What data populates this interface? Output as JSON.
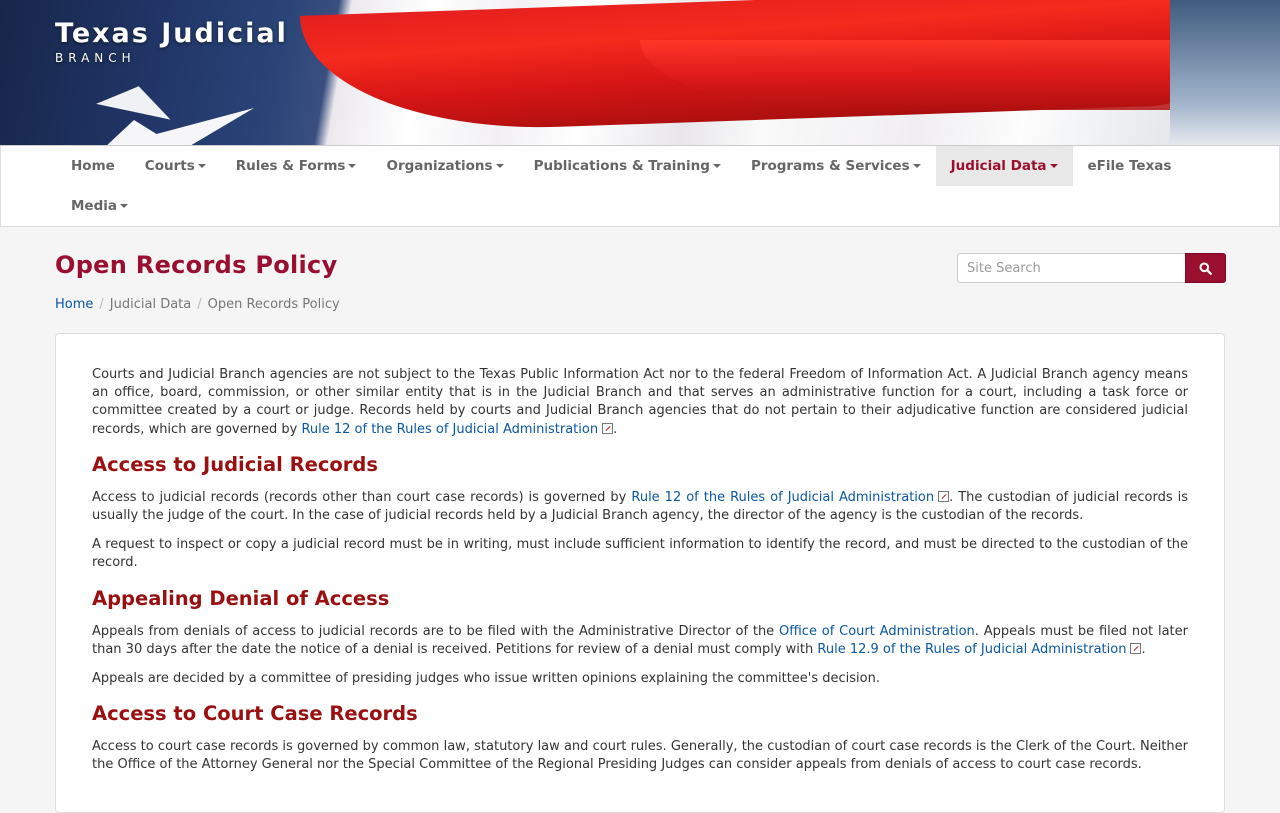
{
  "brand": {
    "title": "Texas Judicial",
    "subtitle": "BRANCH"
  },
  "nav": {
    "row1": [
      {
        "label": "Home",
        "dropdown": false,
        "active": false
      },
      {
        "label": "Courts",
        "dropdown": true,
        "active": false
      },
      {
        "label": "Rules & Forms",
        "dropdown": true,
        "active": false
      },
      {
        "label": "Organizations",
        "dropdown": true,
        "active": false
      },
      {
        "label": "Publications & Training",
        "dropdown": true,
        "active": false
      },
      {
        "label": "Programs & Services",
        "dropdown": true,
        "active": false
      },
      {
        "label": "Judicial Data",
        "dropdown": true,
        "active": true
      },
      {
        "label": "eFile Texas",
        "dropdown": false,
        "active": false
      }
    ],
    "row2": [
      {
        "label": "Media",
        "dropdown": true,
        "active": false
      }
    ]
  },
  "page": {
    "title": "Open Records Policy"
  },
  "breadcrumb": {
    "home": "Home",
    "section": "Judicial Data",
    "current": "Open Records Policy"
  },
  "search": {
    "placeholder": "Site Search",
    "button_icon": "search-icon"
  },
  "content": {
    "intro": {
      "text": "Courts and Judicial Branch agencies are not subject to the Texas Public Information Act nor to the federal Freedom of Information Act. A Judicial Branch agency means an office, board, commission, or other similar entity that is in the Judicial Branch and that serves an administrative function for a court, including a task force or committee created by a court or judge. Records held by courts and Judicial Branch agencies that do not pertain to their adjudicative function are considered judicial records, which are governed by ",
      "link": "Rule 12 of the Rules of Judicial Administration",
      "after": "."
    },
    "s1": {
      "heading": "Access to Judicial Records",
      "p1_before": "Access to judicial records (records other than court case records) is governed by ",
      "p1_link": "Rule 12 of the Rules of Judicial Administration",
      "p1_after": ". The custodian of judicial records is usually the judge of the court. In the case of judicial records held by a Judicial Branch agency, the director of the agency is the custodian of the records.",
      "p2": "A request to inspect or copy a judicial record must be in writing, must include sufficient information to identify the record, and must be directed to the custodian of the record."
    },
    "s2": {
      "heading": "Appealing Denial of Access",
      "p1_before": "Appeals from denials of access to judicial records are to be filed with the Administrative Director of the ",
      "p1_link1": "Office of Court Administration",
      "p1_mid": ". Appeals must be filed not later than 30 days after the date the notice of a denial is received. Petitions for review of a denial must comply with ",
      "p1_link2": "Rule 12.9 of the Rules of Judicial Administration",
      "p1_after": ".",
      "p2": "Appeals are decided by a committee of presiding judges who issue written opinions explaining the committee's decision."
    },
    "s3": {
      "heading": "Access to Court Case Records",
      "p1": "Access to court case records is governed by common law, statutory law and court rules. Generally, the custodian of court case records is the Clerk of the Court. Neither the Office of the Attorney General nor the Special Committee of the Regional Presiding Judges can consider appeals from denials of access to court case records."
    }
  },
  "colors": {
    "brand_red": "#9a0f2f",
    "heading_red": "#9a0f0f",
    "link": "#0a57a4"
  }
}
